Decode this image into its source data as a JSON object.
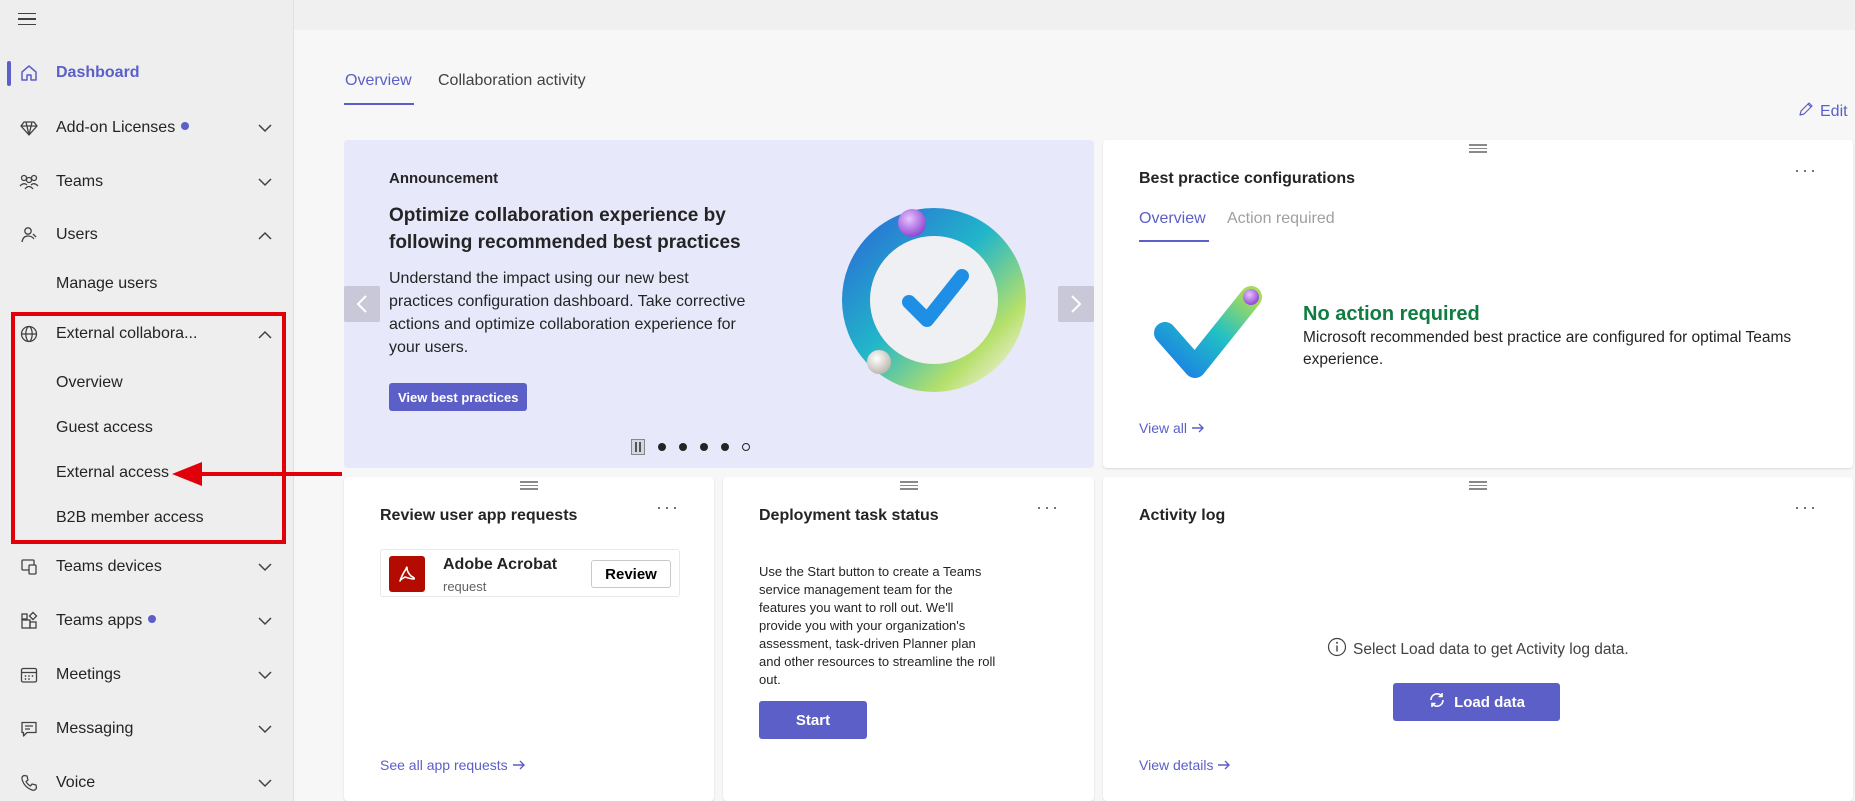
{
  "sidebar": {
    "items": [
      {
        "label": "Dashboard",
        "icon": "home-icon"
      },
      {
        "label": "Add-on Licenses",
        "icon": "diamond-icon"
      },
      {
        "label": "Teams",
        "icon": "people-team-icon"
      },
      {
        "label": "Users",
        "icon": "person-icon"
      },
      {
        "label": "External collabora...",
        "icon": "globe-icon"
      },
      {
        "label": "Teams devices",
        "icon": "devices-icon"
      },
      {
        "label": "Teams apps",
        "icon": "apps-icon"
      },
      {
        "label": "Meetings",
        "icon": "calendar-icon"
      },
      {
        "label": "Messaging",
        "icon": "chat-icon"
      },
      {
        "label": "Voice",
        "icon": "phone-icon"
      }
    ],
    "users_sub": [
      "Manage users"
    ],
    "external_sub": [
      "Overview",
      "Guest access",
      "External access",
      "B2B member access"
    ]
  },
  "tabs": [
    "Overview",
    "Collaboration activity"
  ],
  "edit_label": "Edit",
  "announcement": {
    "label": "Announcement",
    "headline": "Optimize collaboration experience by following recommended best practices",
    "body": "Understand the impact using our new best practices configuration dashboard. Take corrective actions and optimize collaboration experience for your users.",
    "button": "View best practices"
  },
  "best_practice": {
    "title": "Best practice configurations",
    "tabs": [
      "Overview",
      "Action required"
    ],
    "status": "No action required",
    "description": "Microsoft recommended best practice are configured for optimal Teams experience.",
    "link": "View all"
  },
  "review": {
    "title": "Review user app requests",
    "app_name": "Adobe Acrobat",
    "app_sub": "request",
    "button": "Review",
    "link": "See all app requests"
  },
  "deployment": {
    "title": "Deployment task status",
    "text": "Use the Start button to create a Teams service management team for the features you want to roll out. We'll provide you with your organization's assessment, task-driven Planner plan and other resources to streamline the roll out.",
    "button": "Start"
  },
  "activity": {
    "title": "Activity log",
    "info": "Select Load data to get Activity log data.",
    "button": "Load data",
    "link": "View details"
  },
  "colors": {
    "accent": "#5b5fc7",
    "success": "#107c41",
    "highlight": "#e0000a"
  }
}
